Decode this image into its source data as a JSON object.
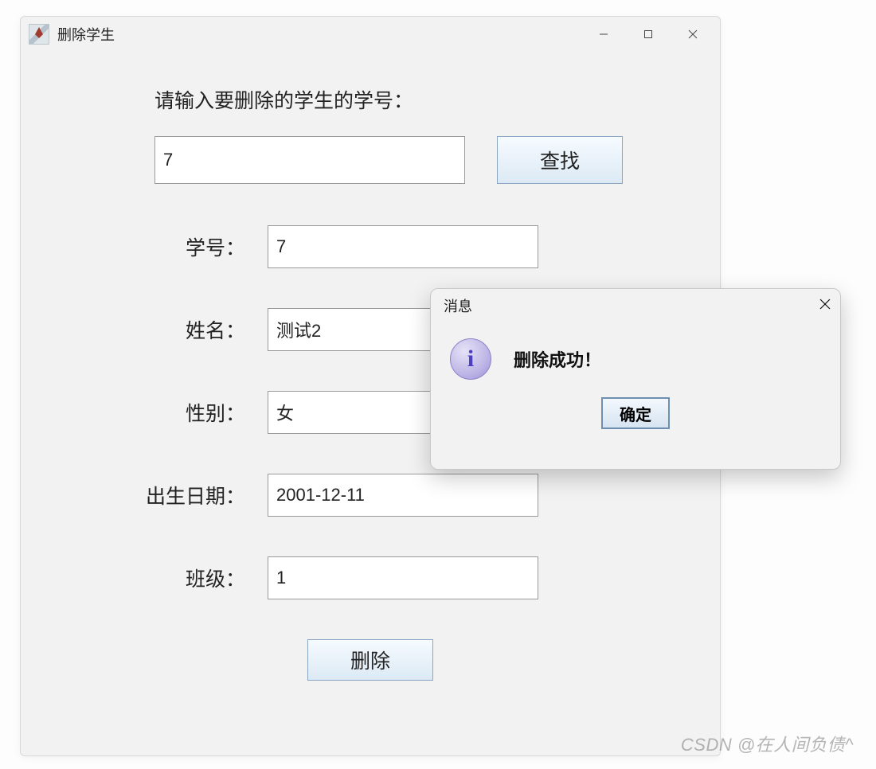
{
  "window": {
    "title": "删除学生"
  },
  "form": {
    "prompt": "请输入要删除的学生的学号：",
    "search_value": "7",
    "search_button": "查找",
    "fields": {
      "id": {
        "label": "学号：",
        "value": "7"
      },
      "name": {
        "label": "姓名：",
        "value": "测试2"
      },
      "gender": {
        "label": "性别：",
        "value": "女"
      },
      "birth": {
        "label": "出生日期：",
        "value": "2001-12-11"
      },
      "class": {
        "label": "班级：",
        "value": "1"
      }
    },
    "delete_button": "删除"
  },
  "dialog": {
    "title": "消息",
    "message": "删除成功！",
    "ok": "确定"
  },
  "watermark": "CSDN @在人间负债^"
}
